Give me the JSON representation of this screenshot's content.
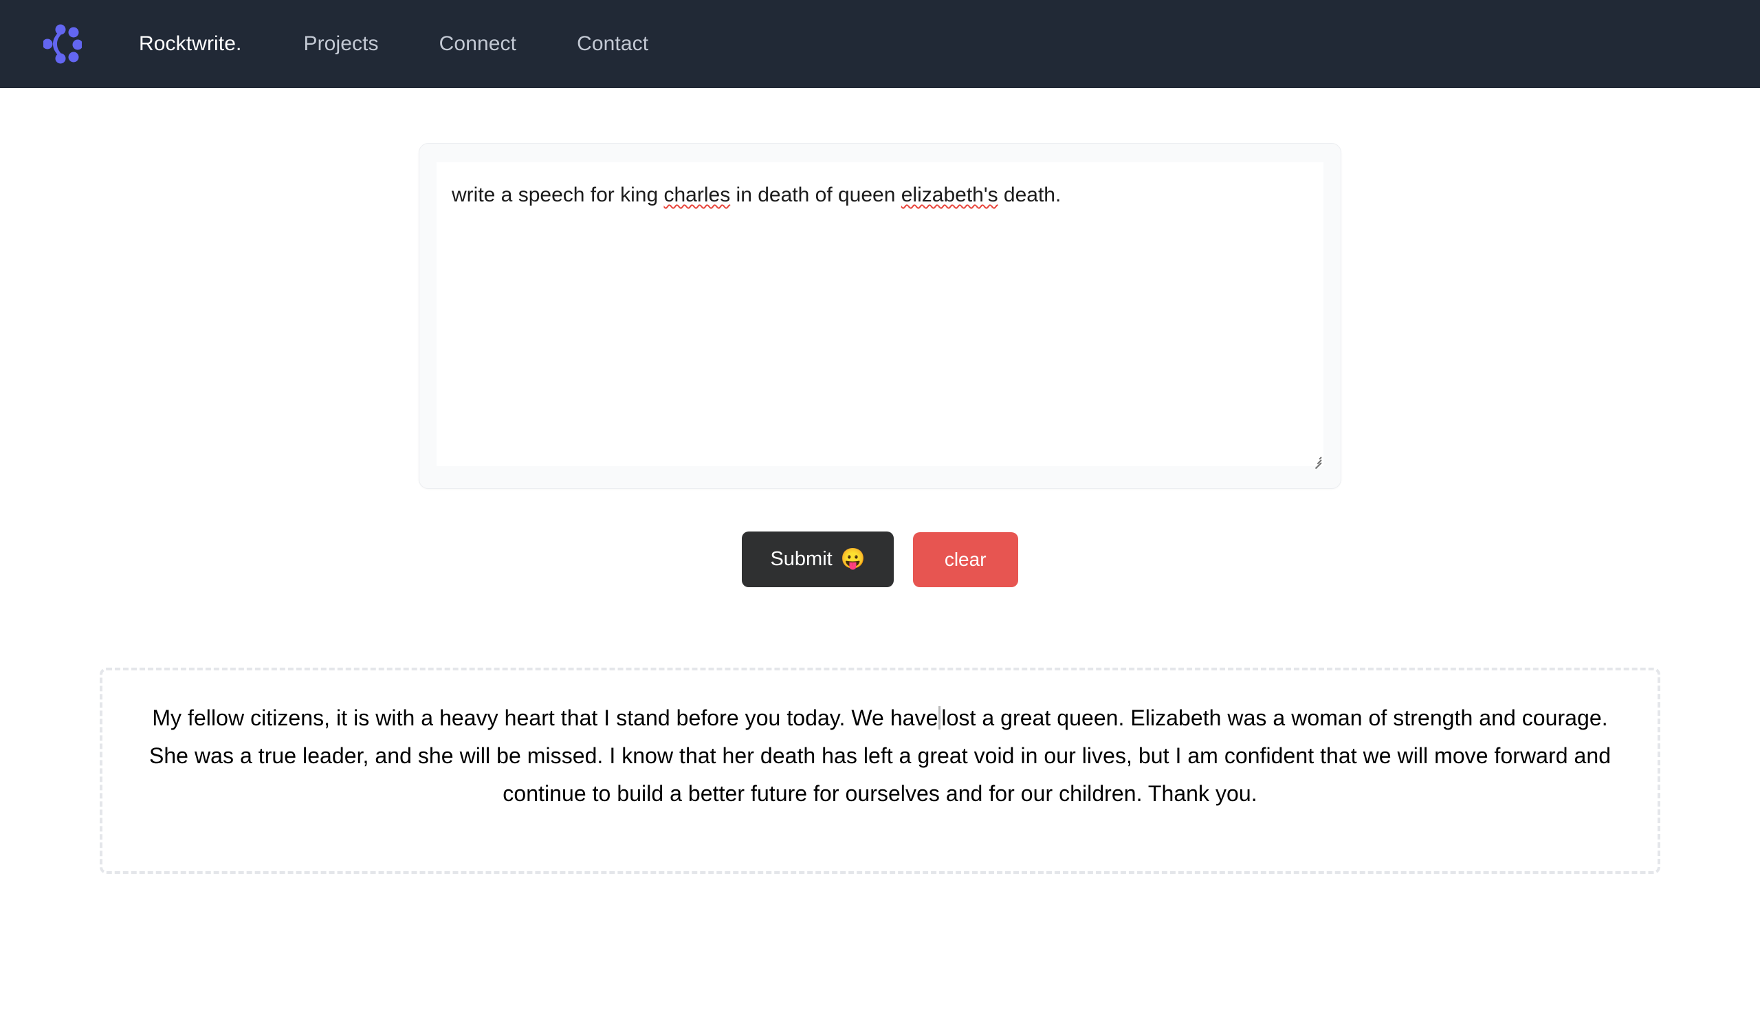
{
  "navbar": {
    "background_color": "#212936",
    "logo_name": "rocktwrite-logo",
    "logo_color": "#6366f1",
    "links": [
      {
        "label": "Rocktwrite.",
        "name": "nav-link-rocktwrite",
        "brand": true
      },
      {
        "label": "Projects",
        "name": "nav-link-projects",
        "brand": false
      },
      {
        "label": "Connect",
        "name": "nav-link-connect",
        "brand": false
      },
      {
        "label": "Contact",
        "name": "nav-link-contact",
        "brand": false
      }
    ]
  },
  "editor": {
    "prompt_value": "write a speech for king charles in death of queen elizabeth's death.",
    "prompt_placeholder": "",
    "prompt_parts": {
      "before_first": "write a speech for king ",
      "misspelled_first": "charles",
      "between": " in death of queen ",
      "misspelled_second": "elizabeth's",
      "after": " death."
    },
    "spellcheck_underline_color": "#e8463c",
    "card_background": "#f9fafb",
    "textarea_background": "#ffffff"
  },
  "buttons": {
    "submit_label": "Submit",
    "submit_emoji": "😛",
    "submit_color": "#2f3031",
    "clear_label": "clear",
    "clear_color": "#e75551"
  },
  "output": {
    "border_color": "#e4e6ea",
    "text_before_caret": "My fellow citizens, it is with a heavy heart that I stand before you today. We have",
    "text_after_caret": "lost a great queen. Elizabeth was a woman of strength and courage. She was a true leader, and she will be missed. I know that her death has left a great void in our lives, but I am confident that we will move forward and continue to build a better future for ourselves and for our children. Thank you.",
    "full_text": "My fellow citizens, it is with a heavy heart that I stand before you today. We have lost a great queen. Elizabeth was a woman of strength and courage. She was a true leader, and she will be missed. I know that her death has left a great void in our lives, but I am confident that we will move forward and continue to build a better future for ourselves and for our children. Thank you."
  }
}
